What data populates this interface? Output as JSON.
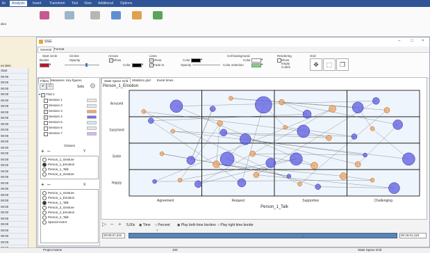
{
  "host": {
    "tabs": [
      "ile",
      "Analysis",
      "Insert",
      "Transform",
      "Tool",
      "View",
      "Additional",
      "Options"
    ],
    "active_tab_index": 1,
    "left_fragments": [
      "dics",
      "es dem"
    ],
    "rows": [
      "Start",
      "00:00",
      "00:00",
      "00:00",
      "00:00",
      "00:00",
      "00:00",
      "00:00",
      "00:00",
      "00:00",
      "00:00",
      "00:00",
      "00:00",
      "00:00",
      "00:00",
      "00:00",
      "00:00",
      "00:00",
      "00:00",
      "00:00",
      "00:00",
      "00:00",
      "00:00",
      "00:00",
      "00:00",
      "00:00",
      "00:00",
      "00:00",
      "00:00",
      "00:00",
      "00:00"
    ],
    "status_left": "Project Name",
    "status_mid": "100",
    "status_right": "State Space Grid"
  },
  "ssg": {
    "title": "SSG",
    "tabs": [
      "General",
      "Format"
    ],
    "active_tab_index": 0,
    "ribbon": {
      "start_circle": "Start circle",
      "border": "Border",
      "circles": "Circles",
      "opacity": "Opacity",
      "arrows": "Arrows",
      "show": "Show",
      "color": "Color",
      "lines": "Lines",
      "lines_show": "Show",
      "fade_to": "Fade to",
      "lines_color": "Color",
      "lines_opacity": "Opacity",
      "cell_background": "Cell background",
      "cell_color": "Color",
      "color_selection": "Color selection",
      "rendering": "Rendering",
      "show_empty_codes": "Show empty Codes",
      "grid": "Grid"
    },
    "colors": {
      "border_swatch": "#c0102a",
      "arrow_color": "#000000",
      "lines_color": "#000000",
      "cell_color": "#ffffff",
      "selection_color": "#7fd07f"
    }
  },
  "filter_panel": {
    "tabs": [
      "Filters",
      "Measures",
      "Key figures"
    ],
    "active_tab_index": 0,
    "sets_label": "Sets",
    "trial_label": "Trial 1",
    "sessions": [
      {
        "label": "Session 1",
        "checked": false,
        "color": "#e6e6e6"
      },
      {
        "label": "Session 2",
        "checked": false,
        "color": "#e6e6e6"
      },
      {
        "label": "Session 3",
        "checked": true,
        "color": "#f4a46a"
      },
      {
        "label": "Session 4",
        "checked": true,
        "color": "#7b6fe0"
      },
      {
        "label": "Session 5",
        "checked": false,
        "color": "#cdeef0"
      },
      {
        "label": "Session 6",
        "checked": false,
        "color": "#e6e6e6"
      },
      {
        "label": "Session 7",
        "checked": false,
        "color": "#d7b6f0"
      }
    ],
    "classes_label": "Classes",
    "y_label": "Y",
    "x_label": "X",
    "y_options": [
      {
        "label": "Person_1_Gesture",
        "selected": false
      },
      {
        "label": "Person_1_Emotion",
        "selected": true
      },
      {
        "label": "Person_1_Talk",
        "selected": false
      },
      {
        "label": "Person_2_Gesture",
        "selected": false
      }
    ],
    "x_options": [
      {
        "label": "Person_1_Gesture",
        "selected": false
      },
      {
        "label": "Person_1_Emotion",
        "selected": false
      },
      {
        "label": "Person_1_Talk",
        "selected": true
      },
      {
        "label": "Person_2_Gesture",
        "selected": false
      },
      {
        "label": "Person_2_Emotion",
        "selected": false
      },
      {
        "label": "Person_2_Talk",
        "selected": false
      },
      {
        "label": "Special event",
        "selected": false
      }
    ]
  },
  "chart_panel": {
    "tabs": [
      "State Space Grid",
      "Statistics grid",
      "Event times"
    ],
    "active_tab_index": 0,
    "y_class_title": "Person_1_Emotion",
    "x_class_title": "Person_1_Talk"
  },
  "chart_data": {
    "type": "scatter",
    "subtype": "state-space-grid",
    "x_categories": [
      "Agreement",
      "Request",
      "Supportive",
      "Challenging"
    ],
    "y_categories": [
      "Happy",
      "Smile",
      "Surprised",
      "Aroused"
    ],
    "xlabel": "Person_1_Talk",
    "ylabel": "Person_1_Emotion",
    "grid": true,
    "series": [
      {
        "color": "#5b5be0",
        "points": [
          [
            0.65,
            3.4,
            9
          ],
          [
            1.15,
            3.3,
            4
          ],
          [
            1.85,
            3.45,
            12
          ],
          [
            2.45,
            3.1,
            6
          ],
          [
            3.15,
            3.35,
            8
          ],
          [
            3.4,
            3.6,
            5
          ],
          [
            0.3,
            2.85,
            4
          ],
          [
            1.3,
            2.4,
            5
          ],
          [
            1.6,
            2.15,
            8
          ],
          [
            2.4,
            2.45,
            9
          ],
          [
            3.1,
            2.25,
            4
          ],
          [
            3.7,
            2.7,
            7
          ],
          [
            0.85,
            1.35,
            6
          ],
          [
            1.35,
            1.4,
            10
          ],
          [
            1.95,
            1.25,
            7
          ],
          [
            2.3,
            1.4,
            9
          ],
          [
            3.85,
            1.4,
            9
          ],
          [
            3.25,
            1.55,
            3
          ],
          [
            0.35,
            0.55,
            3
          ],
          [
            1.55,
            0.5,
            6
          ],
          [
            2.6,
            0.35,
            4
          ],
          [
            3.65,
            0.3,
            8
          ],
          [
            0.95,
            0.45,
            5
          ],
          [
            2.2,
            0.75,
            3
          ]
        ]
      },
      {
        "color": "#f0a15e",
        "points": [
          [
            0.2,
            3.2,
            3
          ],
          [
            1.4,
            3.7,
            3
          ],
          [
            2.1,
            3.55,
            4
          ],
          [
            2.8,
            3.3,
            5
          ],
          [
            3.55,
            3.25,
            4
          ],
          [
            0.6,
            2.45,
            3
          ],
          [
            1.25,
            2.75,
            4
          ],
          [
            2.15,
            2.6,
            3
          ],
          [
            2.75,
            2.2,
            4
          ],
          [
            3.35,
            2.55,
            3
          ],
          [
            0.45,
            1.6,
            3
          ],
          [
            1.2,
            1.2,
            5
          ],
          [
            1.7,
            1.6,
            4
          ],
          [
            2.55,
            1.15,
            5
          ],
          [
            3.15,
            1.2,
            4
          ],
          [
            0.7,
            0.6,
            3
          ],
          [
            1.75,
            0.8,
            4
          ],
          [
            2.35,
            0.45,
            3
          ],
          [
            2.95,
            0.75,
            5
          ],
          [
            3.35,
            0.6,
            3
          ]
        ]
      }
    ]
  },
  "controls": {
    "speed": "5,00x",
    "time_option": "Time",
    "percent_option": "Percent",
    "play_both": "Play both time borders",
    "play_right": "Play right time border",
    "start_time": "00:00:07,242",
    "end_time": "00:16:01,118"
  }
}
